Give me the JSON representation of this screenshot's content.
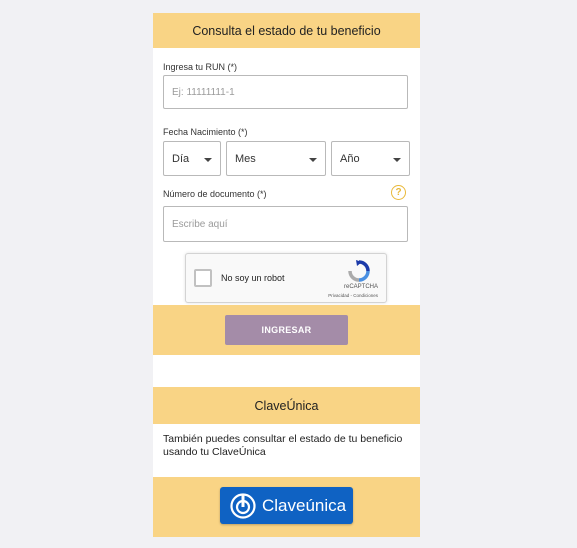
{
  "header": {
    "title": "Consulta el estado de tu beneficio"
  },
  "run": {
    "label": "Ingresa tu RUN (*)",
    "placeholder": "Ej: 11111111-1"
  },
  "birth": {
    "label": "Fecha Nacimiento (*)",
    "day": "Día",
    "month": "Mes",
    "year": "Año"
  },
  "document": {
    "label": "Número de documento (*)",
    "placeholder": "Escribe aquí",
    "help": "?"
  },
  "captcha": {
    "label": "No soy un robot",
    "brand": "reCAPTCHA",
    "links": "Privacidad - Condiciones"
  },
  "submit": {
    "label": "INGRESAR"
  },
  "claveunica": {
    "title": "ClaveÚnica",
    "description": "También puedes consultar el estado de tu beneficio usando tu ClaveÚnica",
    "button_label": "Claveúnica"
  },
  "colors": {
    "accent": "#f9d485",
    "button": "#a48ca8",
    "claveunica_blue": "#0f62c3"
  }
}
